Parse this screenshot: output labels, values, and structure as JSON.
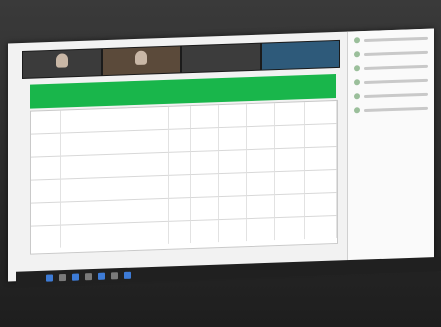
{
  "app": {
    "title": ""
  },
  "video_strip": {
    "tiles": [
      {
        "id": "tile-1",
        "name": "",
        "bg": "#3b3b3b"
      },
      {
        "id": "tile-2",
        "name": "",
        "bg": "#5b4a3a"
      },
      {
        "id": "tile-3",
        "name": "",
        "bg": "#3c3c3c"
      },
      {
        "id": "tile-4",
        "name": "",
        "bg": "#2e5a7a"
      }
    ]
  },
  "banner": {
    "text": ""
  },
  "table": {
    "rows": [
      [
        "",
        "",
        "",
        "",
        "",
        "",
        "",
        ""
      ],
      [
        "",
        "",
        "",
        "",
        "",
        "",
        "",
        ""
      ],
      [
        "",
        "",
        "",
        "",
        "",
        "",
        "",
        ""
      ],
      [
        "",
        "",
        "",
        "",
        "",
        "",
        "",
        ""
      ],
      [
        "",
        "",
        "",
        "",
        "",
        "",
        "",
        ""
      ],
      [
        "",
        "",
        "",
        "",
        "",
        "",
        "",
        ""
      ]
    ]
  },
  "sidebar": {
    "items": [
      {
        "label": "",
        "icon": "participant-icon"
      },
      {
        "label": "",
        "icon": "participant-icon"
      },
      {
        "label": "",
        "icon": "participant-icon"
      },
      {
        "label": "",
        "icon": "participant-icon"
      },
      {
        "label": "",
        "icon": "participant-icon"
      },
      {
        "label": "",
        "icon": "participant-icon"
      }
    ]
  },
  "taskbar": {
    "icons": [
      "start-icon",
      "search-icon",
      "app-icon",
      "app-icon",
      "app-icon",
      "app-icon",
      "app-icon"
    ]
  }
}
